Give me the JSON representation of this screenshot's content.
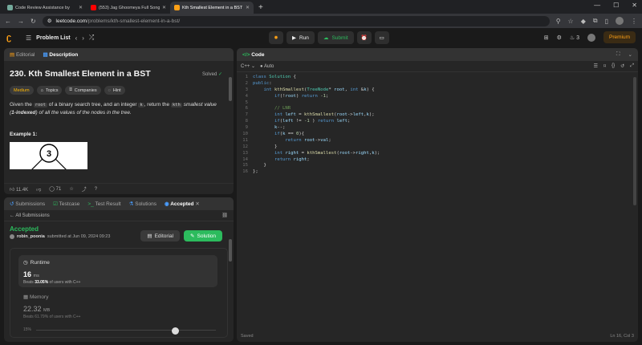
{
  "browser": {
    "tabs": [
      {
        "title": "Code Review Assistance by",
        "color": "#74aa9c",
        "active": false
      },
      {
        "title": "(553) Jag Ghoomeya Full Song",
        "color": "#ff0000",
        "active": false
      },
      {
        "title": "Kth Smallest Element in a BST",
        "color": "#ffa116",
        "active": true
      }
    ],
    "url_host": "leetcode.com",
    "url_path": "/problems/kth-smallest-element-in-a-bst/"
  },
  "nav": {
    "problem_list": "Problem List",
    "run": "Run",
    "submit": "Submit",
    "streak": "3",
    "premium": "Premium"
  },
  "description": {
    "tab_editorial": "Editorial",
    "tab_description": "Description",
    "title": "230. Kth Smallest Element in a BST",
    "solved": "Solved",
    "difficulty": "Medium",
    "tag_topics": "Topics",
    "tag_companies": "Companies",
    "tag_hint": "Hint",
    "text_1": "Given the",
    "code_root": "root",
    "text_2": "of a binary search tree, and an integer",
    "code_k": "k",
    "text_3": ", return the",
    "code_kth": "kth",
    "text_4": "smallest value (",
    "text_5": "1-indexed",
    "text_6": ") of all the values of the nodes in the tree.",
    "example_label": "Example 1:",
    "tree_root": "3",
    "likes": "11.4K",
    "comments": "71"
  },
  "submissions": {
    "tabs": [
      "Submissions",
      "Testcase",
      "Test Result",
      "Solutions",
      "Accepted"
    ],
    "all_submissions": "All Submissions",
    "status": "Accepted",
    "user": "robin_poonia",
    "submitted_at": "submitted at Jun 09, 2024 09:23",
    "editorial_btn": "Editorial",
    "solution_btn": "Solution",
    "runtime_label": "Runtime",
    "runtime_value": "16",
    "runtime_unit": "ms",
    "runtime_beats_label": "Beats",
    "runtime_beats": "33.05%",
    "runtime_beats_suffix": "of users with C++",
    "memory_label": "Memory",
    "memory_value": "22.32",
    "memory_unit": "MB",
    "memory_beats_label": "Beats",
    "memory_beats": "61.79%",
    "memory_beats_suffix": "of users with C++",
    "pct_label": "15%"
  },
  "code": {
    "tab": "Code",
    "language": "C++",
    "mode": "Auto",
    "saved": "Saved",
    "cursor": "Ln 16, Col 3",
    "line_numbers": [
      "1",
      "2",
      "3",
      "4",
      "5",
      "6",
      "7",
      "8",
      "9",
      "10",
      "11",
      "12",
      "13",
      "14",
      "15",
      "16"
    ]
  }
}
